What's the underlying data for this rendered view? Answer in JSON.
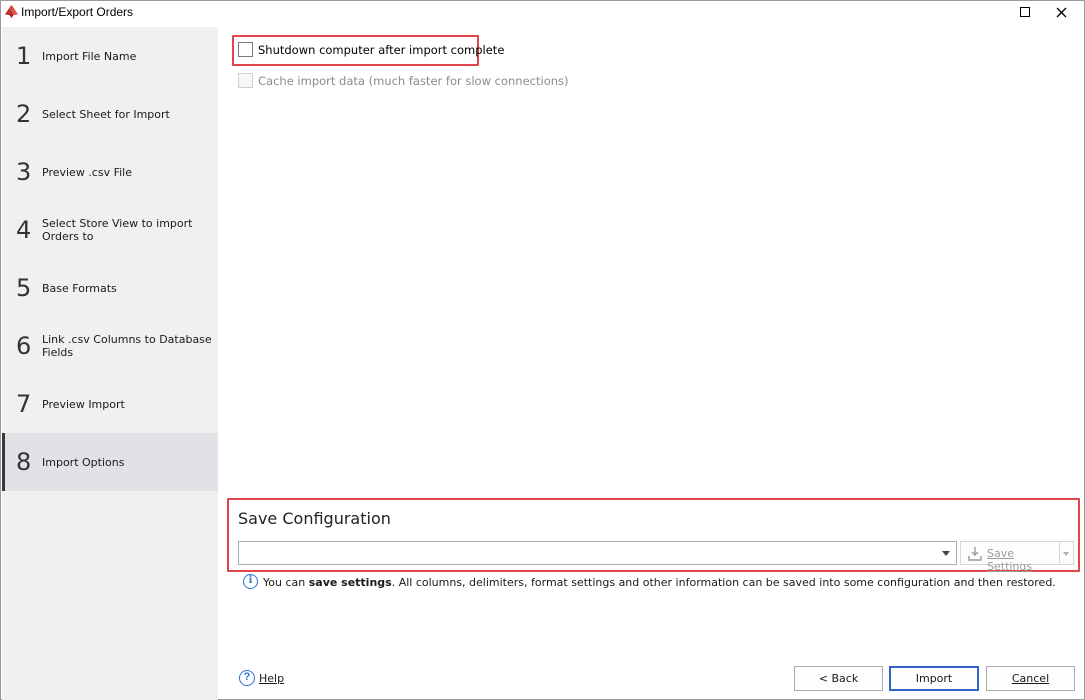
{
  "window": {
    "title": "Import/Export Orders"
  },
  "sidebar": {
    "steps": [
      {
        "num": "1",
        "label": "Import File Name"
      },
      {
        "num": "2",
        "label": "Select Sheet for Import"
      },
      {
        "num": "3",
        "label": "Preview .csv File"
      },
      {
        "num": "4",
        "label": "Select Store View to import Orders to"
      },
      {
        "num": "5",
        "label": "Base Formats"
      },
      {
        "num": "6",
        "label": "Link .csv Columns to Database Fields"
      },
      {
        "num": "7",
        "label": "Preview Import"
      },
      {
        "num": "8",
        "label": "Import Options"
      }
    ],
    "active_step": 8
  },
  "options": {
    "shutdown": {
      "label": "Shutdown computer after import complete",
      "checked": false,
      "enabled": true
    },
    "cache": {
      "label": "Cache import data (much faster for slow connections)",
      "checked": false,
      "enabled": false
    }
  },
  "save_config": {
    "title": "Save Configuration",
    "combo_value": "",
    "save_button": "Save Settings",
    "info_prefix": "You can ",
    "info_bold": "save settings",
    "info_suffix": ". All columns, delimiters, format settings and other information can be saved into some configuration and then restored."
  },
  "footer": {
    "help": "Help",
    "back": "< Back",
    "import": "Import",
    "cancel": "Cancel"
  },
  "colors": {
    "highlight": "#e0474c",
    "sidebar_bg": "#f0f0f0",
    "active_step_bg": "#e1e1e6",
    "accent_blue": "#2c6fd6"
  },
  "icons": {
    "app": "app-logo-icon",
    "maximize": "maximize-icon",
    "close": "close-icon",
    "save": "save-download-icon",
    "info": "info-icon",
    "help": "help-icon"
  }
}
